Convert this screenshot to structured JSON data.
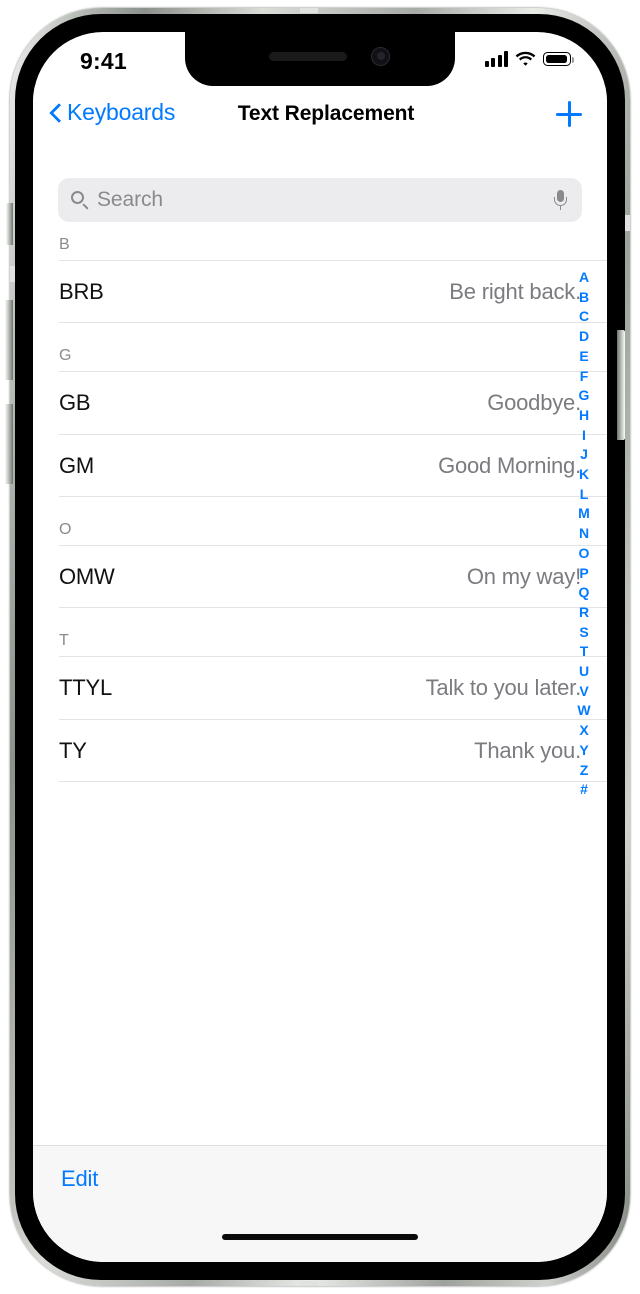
{
  "status_bar": {
    "time": "9:41",
    "cellular_icon": "cellular-signal-icon",
    "wifi_icon": "wifi-icon",
    "battery_icon": "battery-full-icon"
  },
  "nav": {
    "back_label": "Keyboards",
    "back_icon": "chevron-left-icon",
    "title": "Text Replacement",
    "add_icon": "plus-icon"
  },
  "search": {
    "placeholder": "Search",
    "value": "",
    "search_icon": "search-icon",
    "dictation_icon": "microphone-icon"
  },
  "sections": [
    {
      "header": "B",
      "rows": [
        {
          "shortcut": "BRB",
          "phrase": "Be right back."
        }
      ]
    },
    {
      "header": "G",
      "rows": [
        {
          "shortcut": "GB",
          "phrase": "Goodbye."
        },
        {
          "shortcut": "GM",
          "phrase": "Good Morning."
        }
      ]
    },
    {
      "header": "O",
      "rows": [
        {
          "shortcut": "OMW",
          "phrase": "On my way!"
        }
      ]
    },
    {
      "header": "T",
      "rows": [
        {
          "shortcut": "TTYL",
          "phrase": "Talk to you later."
        },
        {
          "shortcut": "TY",
          "phrase": "Thank you."
        }
      ]
    }
  ],
  "index_bar": {
    "entries": [
      "A",
      "B",
      "C",
      "D",
      "E",
      "F",
      "G",
      "H",
      "I",
      "J",
      "K",
      "L",
      "M",
      "N",
      "O",
      "P",
      "Q",
      "R",
      "S",
      "T",
      "U",
      "V",
      "W",
      "X",
      "Y",
      "Z",
      "#"
    ]
  },
  "toolbar": {
    "edit_label": "Edit"
  },
  "colors": {
    "accent_blue": "#027aff",
    "index_blue": "#037aff",
    "secondary_text": "#7b7b80",
    "section_header_text": "#8b8b8f",
    "separator": "#e3e3e5",
    "search_field_bg": "#ececee",
    "toolbar_bg": "#f7f7f7"
  }
}
